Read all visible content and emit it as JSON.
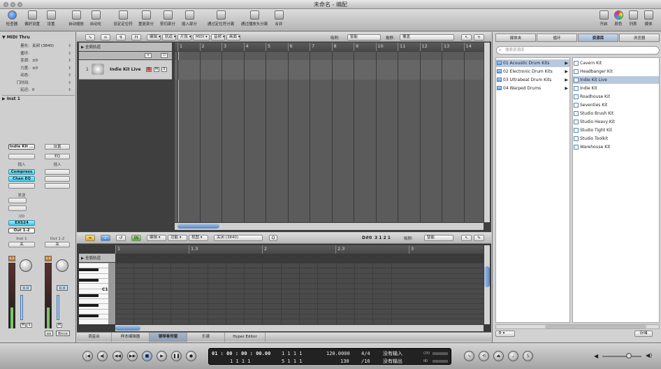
{
  "window": {
    "title": "未命名 - 编配"
  },
  "toolbar": {
    "inspector": "检查器",
    "prefs": "偏好设置",
    "settings": "设置",
    "auto_zoom": "自动缩放",
    "automation": "自动化",
    "set_locators": "设定定位符",
    "repeat_section": "重复部分",
    "cut_section": "剪切部分",
    "insert_section": "插入部分",
    "split_by_locators": "通过定位符分离",
    "split_by_playhead": "通过播放头分离",
    "merge": "合并",
    "colors": "颜色",
    "lists": "列表",
    "media": "媒体"
  },
  "inspector": {
    "region_header": "MIDI Thru",
    "params": [
      {
        "key": "量化:",
        "value": "关闭 (3840)"
      },
      {
        "key": "循环:",
        "value": ""
      },
      {
        "key": "变调:",
        "value": "±0"
      },
      {
        "key": "力度:",
        "value": "±0"
      },
      {
        "key": "动态:",
        "value": ""
      },
      {
        "key": "门时间:",
        "value": ""
      },
      {
        "key": "延迟:",
        "value": "0"
      }
    ],
    "track_header": "Inst 1",
    "strip1": {
      "setting": "Indie Kit ...",
      "eq": "",
      "inserts_label": "插入",
      "insert1": "Compress",
      "insert2": "Chan EQ",
      "sends_label": "发送",
      "io_label": "I/O",
      "input": "EXS24",
      "output": "Out 1-2",
      "auto": "关",
      "name": "Inst 1",
      "value": "0.0",
      "peak": "4.6"
    },
    "strip2": {
      "setting": "设置",
      "eq": "EQ",
      "inserts_label": "插入",
      "output": "Out 1-2",
      "auto": "关",
      "value": "0.0",
      "peak": "4.6",
      "bnce": "Bnce"
    }
  },
  "arrange": {
    "menus": [
      "编辑",
      "轨道",
      "片段",
      "MIDI",
      "音频",
      "画面"
    ],
    "snap_label": "吸附:",
    "snap_value": "智能",
    "drag_label": "拖移:",
    "drag_value": "覆盖",
    "global_tracks": "全局轨道",
    "track_number": "1",
    "track_name": "Indie Kit Live",
    "ruler": [
      "1",
      "2",
      "3",
      "4",
      "5",
      "6",
      "7",
      "8",
      "9",
      "10",
      "11",
      "12",
      "13",
      "14"
    ]
  },
  "editor": {
    "menus": [
      "编辑",
      "功能",
      "视图"
    ],
    "quant_value": "关闭 (3840)",
    "q_button": "Q",
    "position": "D#0",
    "position_value": "3 1 2 1",
    "snap_label": "吸附:",
    "snap_value": "智能",
    "global_tracks": "全局轨道",
    "key_label": "C1",
    "ruler": [
      "1",
      "1.3",
      "2",
      "2.3",
      "3"
    ],
    "tabs": [
      "调音台",
      "样本编辑器",
      "钢琴卷帘窗",
      "乐谱",
      "Hyper Editor"
    ],
    "active_tab": "钢琴卷帘窗"
  },
  "media": {
    "tabs": [
      "媒体夹",
      "循环",
      "资源库",
      "浏览器"
    ],
    "active_tab": "资源库",
    "search_placeholder": "搜索资源库",
    "folders": [
      "01 Acoustic Drum Kits",
      "02 Electronic Drum Kits",
      "03 Ultrabeat Drum Kits",
      "04 Warped Drums"
    ],
    "selected_folder": "01 Acoustic Drum Kits",
    "patches": [
      "Cavern Kit",
      "Headbanger Kit",
      "Indie Kit Live",
      "Indie Kit",
      "Roadhouse Kit",
      "Seventies Kit",
      "Studio Brush Kit",
      "Studio Heavy Kit",
      "Studio Tight Kit",
      "Studio Toolkit",
      "Warehouse Kit"
    ],
    "selected_patch": "Indie Kit Live",
    "save_button": "存储"
  },
  "transport": {
    "smpte": "01 : 00 : 00 : 00.00",
    "bars_main": "1     1     1     1",
    "bars_sub": "1     1     1     1",
    "bars_pos2": "5     1     1     1",
    "tempo_top": "120.0000",
    "tempo_bottom": "130",
    "sig_top": "4/4",
    "sig_bottom": "/16",
    "in_status": "没有输入",
    "out_status": "没有输出",
    "cpu_label": "CPU",
    "hd_label": "HD"
  }
}
